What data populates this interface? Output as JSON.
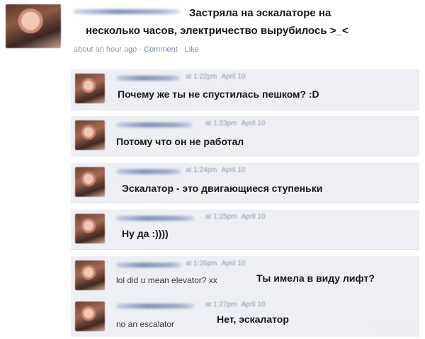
{
  "post": {
    "text_line1": "Застряла на эскалаторе на",
    "text_line2": "несколько часов, электричество вырубилось >_<",
    "meta_time": "about an hour ago",
    "meta_comment": "Comment",
    "meta_like": "Like",
    "separator": "·"
  },
  "replies": [
    {
      "time": "at 1:22pm",
      "date": "April 10",
      "text": "Почему же ты не спустилась пешком? :D",
      "english": ""
    },
    {
      "time": "at 1:23pm",
      "date": "April 10",
      "text": "Потому что он не работал",
      "english": ""
    },
    {
      "time": "at 1:24pm",
      "date": "April 10",
      "text": "Эскалатор - это двигающиеся ступеньки",
      "english": ""
    },
    {
      "time": "at 1:25pm",
      "date": "April 10",
      "text": "Ну да :))))",
      "english": ""
    },
    {
      "time": "at 1:26pm",
      "date": "April 10",
      "text": "Ты имела в виду лифт?",
      "english": "lol did u mean elevator? xx"
    },
    {
      "time": "at 1:27pm",
      "date": "April 10",
      "text": "Нет, эскалатор",
      "english": "no an escalator"
    }
  ]
}
